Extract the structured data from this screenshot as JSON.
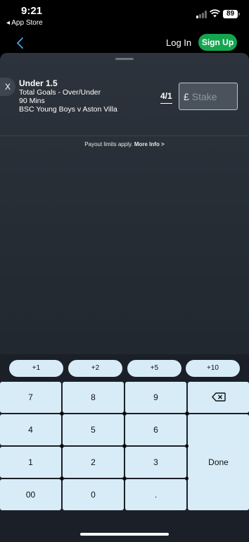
{
  "status_bar": {
    "time": "9:21",
    "back_label": "◂ App Store",
    "battery": "89"
  },
  "nav": {
    "login": "Log In",
    "signup": "Sign Up"
  },
  "selection": {
    "remove": "X",
    "name": "Under 1.5",
    "market": "Total Goals - Over/Under",
    "period": "90 Mins",
    "event": "BSC Young Boys v Aston Villa",
    "odds": "4/1",
    "currency": "£",
    "stake_placeholder": "Stake"
  },
  "payout": {
    "text": "Payout limits apply. ",
    "link": "More Info >"
  },
  "quick_stakes": [
    "+1",
    "+2",
    "+5",
    "+10"
  ],
  "keypad": {
    "k7": "7",
    "k8": "8",
    "k9": "9",
    "k4": "4",
    "k5": "5",
    "k6": "6",
    "k1": "1",
    "k2": "2",
    "k3": "3",
    "k00": "00",
    "k0": "0",
    "kdot": ".",
    "done": "Done",
    "backspace_icon": "backspace-icon"
  },
  "colors": {
    "signup_green": "#14a54f",
    "key_bg": "#d7ecf7",
    "sheet_bg": "#2c333c"
  }
}
